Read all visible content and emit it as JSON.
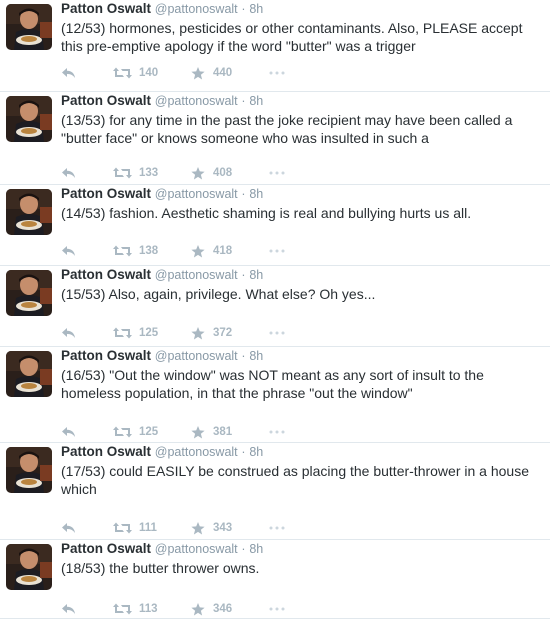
{
  "colors": {
    "name": "#292f33",
    "meta": "#8899a6",
    "action": "#aab8c2",
    "divider": "#e1e8ed"
  },
  "icons": {
    "reply": "reply-arrow-icon",
    "retweet": "retweet-icon",
    "favorite": "star-icon",
    "more": "more-dots-icon"
  },
  "tweets": [
    {
      "name": "Patton Oswalt",
      "handle": "@pattonoswalt",
      "separator": "·",
      "time": "8h",
      "text": "(12/53) hormones, pesticides or other contaminants. Also, PLEASE accept this pre-emptive apology if the word \"butter\" was a trigger",
      "retweets": "140",
      "favorites": "440"
    },
    {
      "name": "Patton Oswalt",
      "handle": "@pattonoswalt",
      "separator": "·",
      "time": "8h",
      "text": "(13/53) for any time in the past the joke recipient may have been called a \"butter face\" or knows someone who was insulted in such a",
      "retweets": "133",
      "favorites": "408"
    },
    {
      "name": "Patton Oswalt",
      "handle": "@pattonoswalt",
      "separator": "·",
      "time": "8h",
      "text": "(14/53) fashion. Aesthetic shaming is real and bullying hurts us all.",
      "retweets": "138",
      "favorites": "418"
    },
    {
      "name": "Patton Oswalt",
      "handle": "@pattonoswalt",
      "separator": "·",
      "time": "8h",
      "text": "(15/53) Also, again, privilege. What else? Oh yes...",
      "retweets": "125",
      "favorites": "372"
    },
    {
      "name": "Patton Oswalt",
      "handle": "@pattonoswalt",
      "separator": "·",
      "time": "8h",
      "text": "(16/53) \"Out the window\" was NOT meant as any sort of insult to the homeless population, in that the phrase \"out the window\"",
      "retweets": "125",
      "favorites": "381"
    },
    {
      "name": "Patton Oswalt",
      "handle": "@pattonoswalt",
      "separator": "·",
      "time": "8h",
      "text": "(17/53) could EASILY be construed as placing the butter-thrower in a house which",
      "retweets": "111",
      "favorites": "343"
    },
    {
      "name": "Patton Oswalt",
      "handle": "@pattonoswalt",
      "separator": "·",
      "time": "8h",
      "text": "(18/53) the butter thrower owns.",
      "retweets": "113",
      "favorites": "346"
    }
  ]
}
